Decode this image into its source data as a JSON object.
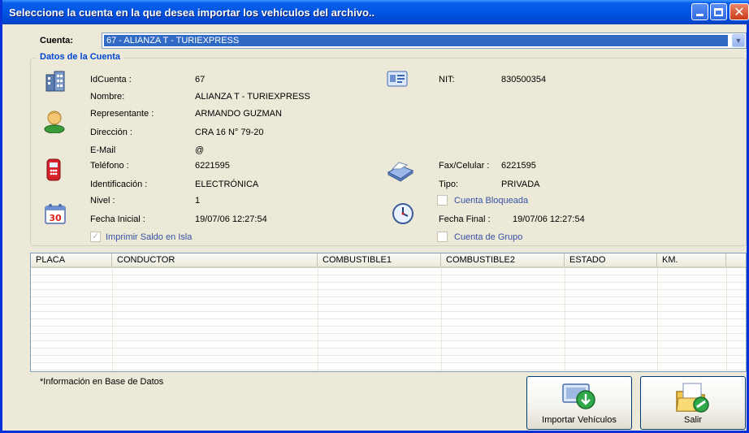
{
  "window": {
    "title": "Seleccione la cuenta en la que desea importar los vehículos del archivo..",
    "controls": {
      "minimize": "minimize-icon",
      "maximize": "maximize-icon",
      "close": "close-icon"
    }
  },
  "cuenta": {
    "label": "Cuenta:",
    "selected": "67 - ALIANZA T - TURIEXPRESS"
  },
  "datos": {
    "title": "Datos de la Cuenta",
    "idcuenta_label": "IdCuenta :",
    "idcuenta": "67",
    "nombre_label": "Nombre:",
    "nombre": "ALIANZA T - TURIEXPRESS",
    "representante_label": "Representante :",
    "representante": "ARMANDO GUZMAN",
    "direccion_label": "Dirección :",
    "direccion": "CRA 16 N° 79-20",
    "email_label": "E-Mail",
    "email": "@",
    "telefono_label": "Teléfono :",
    "telefono": "6221595",
    "identificacion_label": "Identificación :",
    "identificacion": "ELECTRÓNICA",
    "nivel_label": "Nivel :",
    "nivel": "1",
    "fecha_inicial_label": "Fecha Inicial :",
    "fecha_inicial": "19/07/06 12:27:54",
    "imprimir_saldo_label": "Imprimir Saldo en Isla",
    "imprimir_saldo_checked": true,
    "nit_label": "NIT:",
    "nit": "830500354",
    "fax_label": "Fax/Celular :",
    "fax": "6221595",
    "tipo_label": "Tipo:",
    "tipo": "PRIVADA",
    "cuenta_bloqueada_label": "Cuenta Bloqueada",
    "cuenta_bloqueada_checked": false,
    "fecha_final_label": "Fecha Final :",
    "fecha_final": "19/07/06 12:27:54",
    "cuenta_grupo_label": "Cuenta de Grupo",
    "cuenta_grupo_checked": false
  },
  "grid": {
    "columns": [
      "PLACA",
      "CONDUCTOR",
      "COMBUSTIBLE1",
      "COMBUSTIBLE2",
      "ESTADO",
      "KM."
    ],
    "rows": []
  },
  "footer": {
    "note": "*Información en Base de Datos",
    "importar_label": "Importar Vehículos",
    "salir_label": "Salir"
  },
  "colors": {
    "titlebar": "#0055E5",
    "group_title": "#0046D5",
    "selection": "#316AC5",
    "window_bg": "#ECE9D8"
  }
}
